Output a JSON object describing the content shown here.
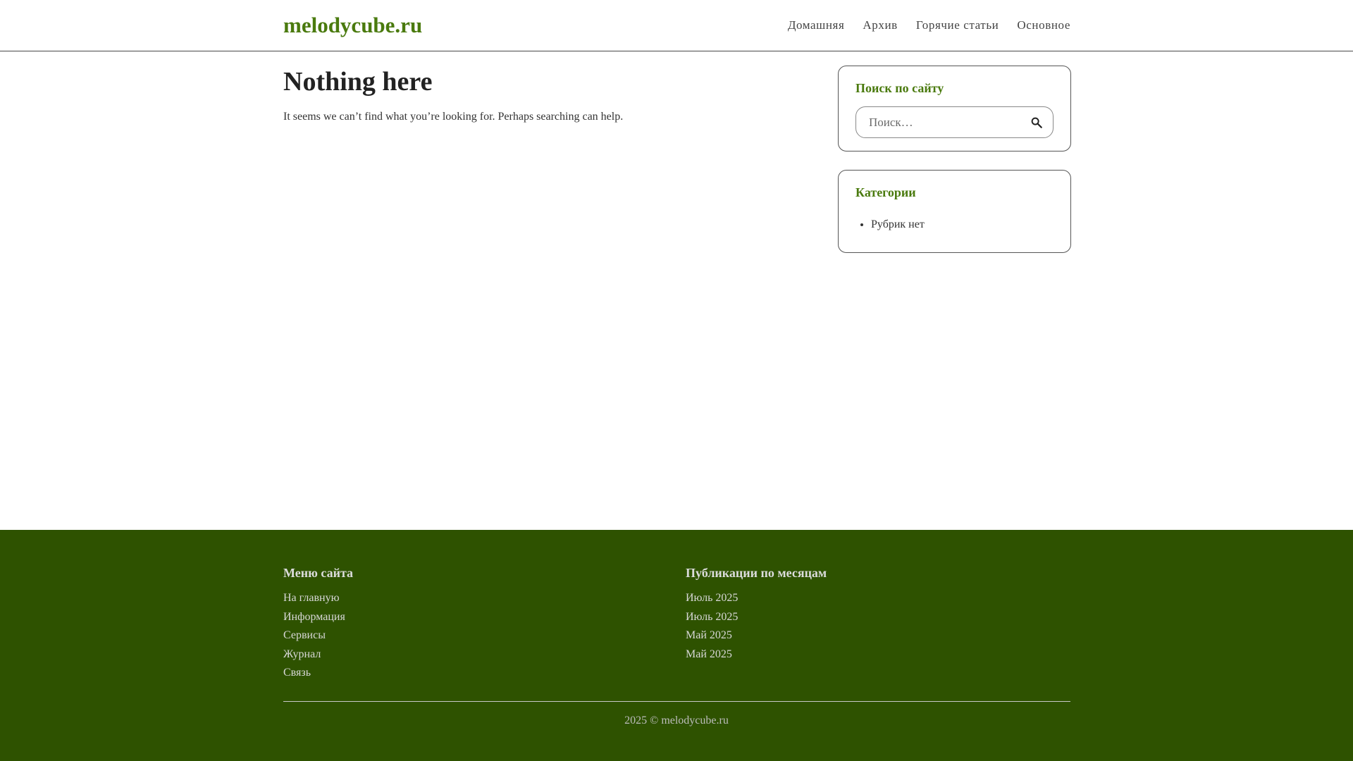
{
  "header": {
    "site_title": "melodycube.ru",
    "nav": [
      {
        "label": "Домашняя"
      },
      {
        "label": "Архив"
      },
      {
        "label": "Горячие статьи"
      },
      {
        "label": "Основное"
      }
    ]
  },
  "main": {
    "title": "Nothing here",
    "text": "It seems we can’t find what you’re looking for. Perhaps searching can help."
  },
  "sidebar": {
    "search": {
      "title": "Поиск по сайту",
      "placeholder": "Поиск…",
      "value": "",
      "button_icon": "search-icon"
    },
    "categories": {
      "title": "Категории",
      "items": [
        "Рубрик нет"
      ]
    }
  },
  "footer": {
    "menu": {
      "title": "Меню сайта",
      "links": [
        "На главную",
        "Информация",
        "Сервисы",
        "Журнал",
        "Связь"
      ]
    },
    "archives": {
      "title": "Публикации по месяцам",
      "links": [
        "Июль 2025",
        "Июль 2025",
        "Май 2025",
        "Май 2025"
      ]
    },
    "copyright": "2025 © melodycube.ru"
  },
  "colors": {
    "accent": "#4a7a0e",
    "footer_bg": "#2e5200",
    "text": "#222222"
  }
}
